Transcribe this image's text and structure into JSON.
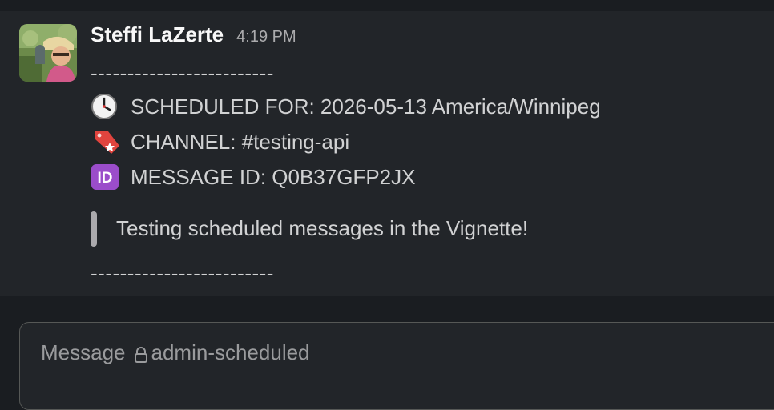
{
  "message": {
    "author": "Steffi LaZerte",
    "timestamp": "4:19 PM",
    "separator_top": "-------------------------",
    "scheduled_for": "SCHEDULED FOR: 2026-05-13 America/Winnipeg",
    "channel": "CHANNEL: #testing-api",
    "message_id": "MESSAGE ID: Q0B37GFP2JX",
    "quote": "Testing scheduled messages in the Vignette!",
    "separator_bottom": "-------------------------",
    "icons": {
      "scheduled": "clock-icon",
      "channel": "bookmark-tag-icon",
      "message_id": "id-badge-icon"
    }
  },
  "composer": {
    "placeholder_prefix": "Message",
    "channel_name": "admin-scheduled",
    "lock_icon": "lock-icon"
  },
  "colors": {
    "background": "#1a1d21",
    "message_bg": "#222529",
    "text": "#d1d2d3",
    "author": "#f8f8f8",
    "id_badge": "#9b4dca",
    "tag": "#e03e3e"
  }
}
